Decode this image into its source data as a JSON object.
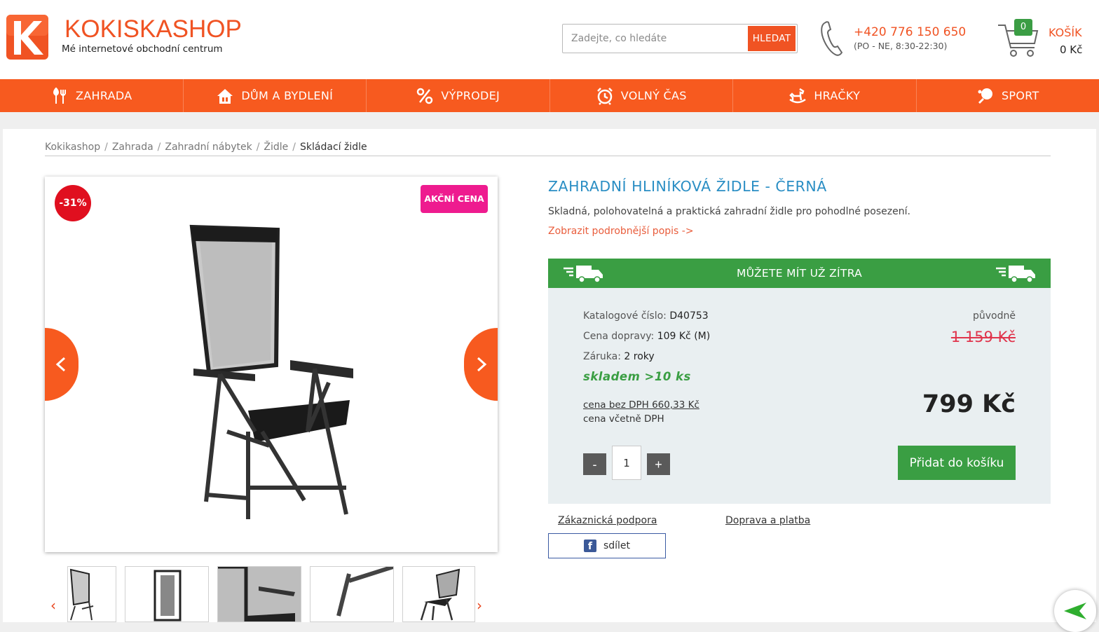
{
  "header": {
    "logo_title": "KOKISKASHOP",
    "logo_subtitle": "Mé internetové obchodní centrum",
    "search_placeholder": "Zadejte, co hledáte",
    "search_button": "HLEDAT",
    "phone": "+420 776 150 650",
    "phone_hours": "(PO - NE, 8:30-22:30)",
    "cart_count": "0",
    "cart_label": "KOŠÍK",
    "cart_total": "0 Kč"
  },
  "nav": [
    {
      "label": "ZAHRADA",
      "icon": "garden-tools-icon"
    },
    {
      "label": "DŮM A BYDLENÍ",
      "icon": "house-icon"
    },
    {
      "label": "VÝPRODEJ",
      "icon": "percent-icon"
    },
    {
      "label": "VOLNÝ ČAS",
      "icon": "alarm-clock-icon"
    },
    {
      "label": "HRAČKY",
      "icon": "rocking-horse-icon"
    },
    {
      "label": "SPORT",
      "icon": "ping-pong-icon"
    }
  ],
  "breadcrumb": [
    "Kokikashop",
    "Zahrada",
    "Zahradní nábytek",
    "Židle",
    "Skládací židle"
  ],
  "product": {
    "discount": "-31%",
    "action_badge": "AKČNÍ CENA",
    "title": "ZAHRADNÍ HLINÍKOVÁ ŽIDLE - ČERNÁ",
    "short_description": "Skladná, polohovatelná a praktická zahradní židle pro pohodlné posezení.",
    "more_link": "Zobrazit podrobnější popis ->",
    "delivery_banner": "MŮŽETE MÍT UŽ ZÍTRA",
    "catalog_label": "Katalogové číslo:",
    "catalog_value": "D40753",
    "shipping_label": "Cena dopravy:",
    "shipping_value": "109 Kč (M)",
    "warranty_label": "Záruka:",
    "warranty_value": "2 roky",
    "stock": "skladem >10 ks",
    "original_label": "původně",
    "original_price": "1 159 Kč",
    "price": "799 Kč",
    "price_no_vat": "cena bez DPH 660,33 Kč",
    "price_vat_label": "cena včetně DPH",
    "qty_minus": "-",
    "qty_value": "1",
    "qty_plus": "+",
    "add_to_cart": "Přidat do košíku"
  },
  "links": {
    "support": "Zákaznická podpora",
    "delivery": "Doprava a platba",
    "share": "sdílet"
  },
  "colors": {
    "brand_orange": "#f75a1f",
    "green": "#3a9e43",
    "title_blue": "#2a8ec4",
    "discount_red": "#e00f1f",
    "action_pink": "#ee1b8f"
  }
}
